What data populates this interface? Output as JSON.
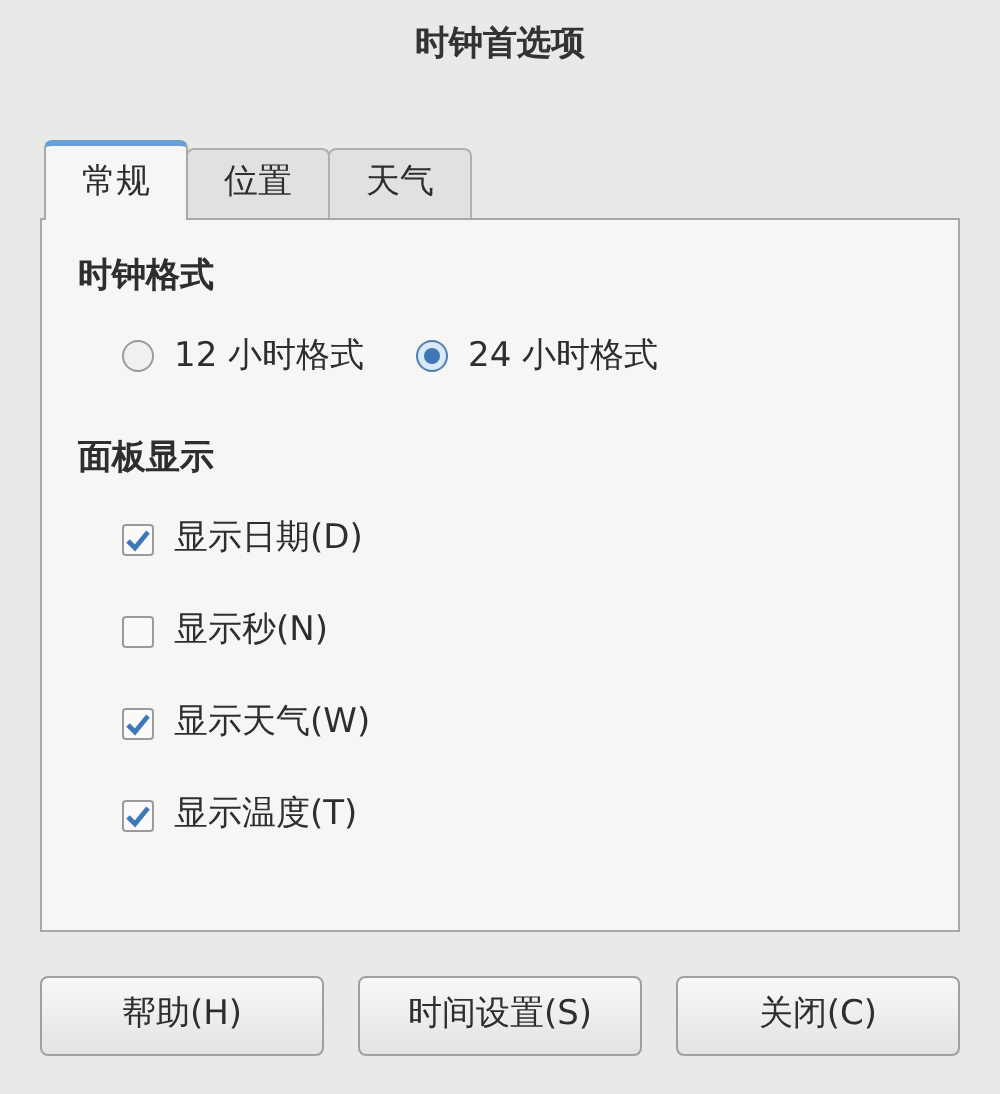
{
  "window": {
    "title": "时钟首选项"
  },
  "tabs": [
    {
      "label": "常规",
      "selected": true
    },
    {
      "label": "位置",
      "selected": false
    },
    {
      "label": "天气",
      "selected": false
    }
  ],
  "clock_format": {
    "heading": "时钟格式",
    "options": [
      {
        "label": "12 小时格式",
        "selected": false
      },
      {
        "label": "24 小时格式",
        "selected": true
      }
    ]
  },
  "panel_display": {
    "heading": "面板显示",
    "items": [
      {
        "label": "显示日期(D)",
        "checked": true
      },
      {
        "label": "显示秒(N)",
        "checked": false
      },
      {
        "label": "显示天气(W)",
        "checked": true
      },
      {
        "label": "显示温度(T)",
        "checked": true
      }
    ]
  },
  "buttons": [
    "帮助(H)",
    "时间设置(S)",
    "关闭(C)"
  ]
}
